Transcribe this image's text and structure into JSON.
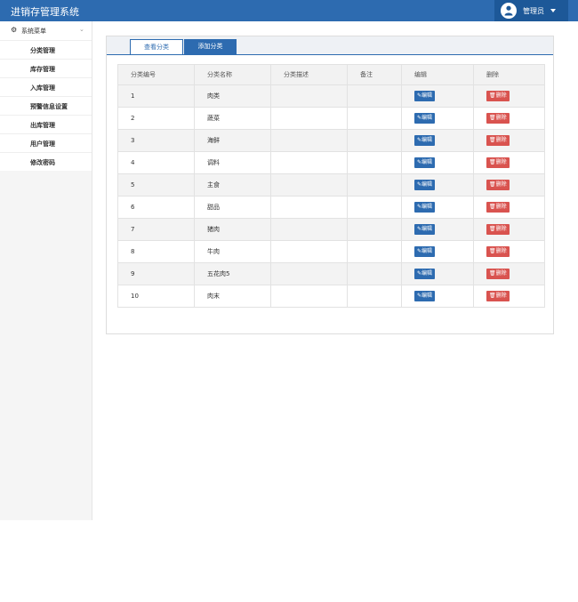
{
  "header": {
    "title": "进销存管理系统",
    "user_label": "管理员"
  },
  "sidebar": {
    "header_label": "系统菜单",
    "items": [
      {
        "label": "分类管理"
      },
      {
        "label": "库存管理"
      },
      {
        "label": "入库管理"
      },
      {
        "label": "预警信息设置"
      },
      {
        "label": "出库管理"
      },
      {
        "label": "用户管理"
      },
      {
        "label": "修改密码"
      }
    ]
  },
  "tabs": {
    "view": "查看分类",
    "add": "添加分类"
  },
  "table": {
    "columns": [
      "分类编号",
      "分类名称",
      "分类描述",
      "备注",
      "编辑",
      "删除"
    ],
    "edit_label": "编辑",
    "delete_label": "删除",
    "rows": [
      {
        "id": "1",
        "name": "肉类",
        "desc": "",
        "note": ""
      },
      {
        "id": "2",
        "name": "蔬菜",
        "desc": "",
        "note": ""
      },
      {
        "id": "3",
        "name": "海鲜",
        "desc": "",
        "note": ""
      },
      {
        "id": "4",
        "name": "调料",
        "desc": "",
        "note": ""
      },
      {
        "id": "5",
        "name": "主食",
        "desc": "",
        "note": ""
      },
      {
        "id": "6",
        "name": "甜品",
        "desc": "",
        "note": ""
      },
      {
        "id": "7",
        "name": "猪肉",
        "desc": "",
        "note": ""
      },
      {
        "id": "8",
        "name": "牛肉",
        "desc": "",
        "note": ""
      },
      {
        "id": "9",
        "name": "五花肉5",
        "desc": "",
        "note": ""
      },
      {
        "id": "10",
        "name": "肉末",
        "desc": "",
        "note": ""
      }
    ]
  },
  "colors": {
    "primary": "#2d6bb0",
    "danger": "#d9534f"
  }
}
